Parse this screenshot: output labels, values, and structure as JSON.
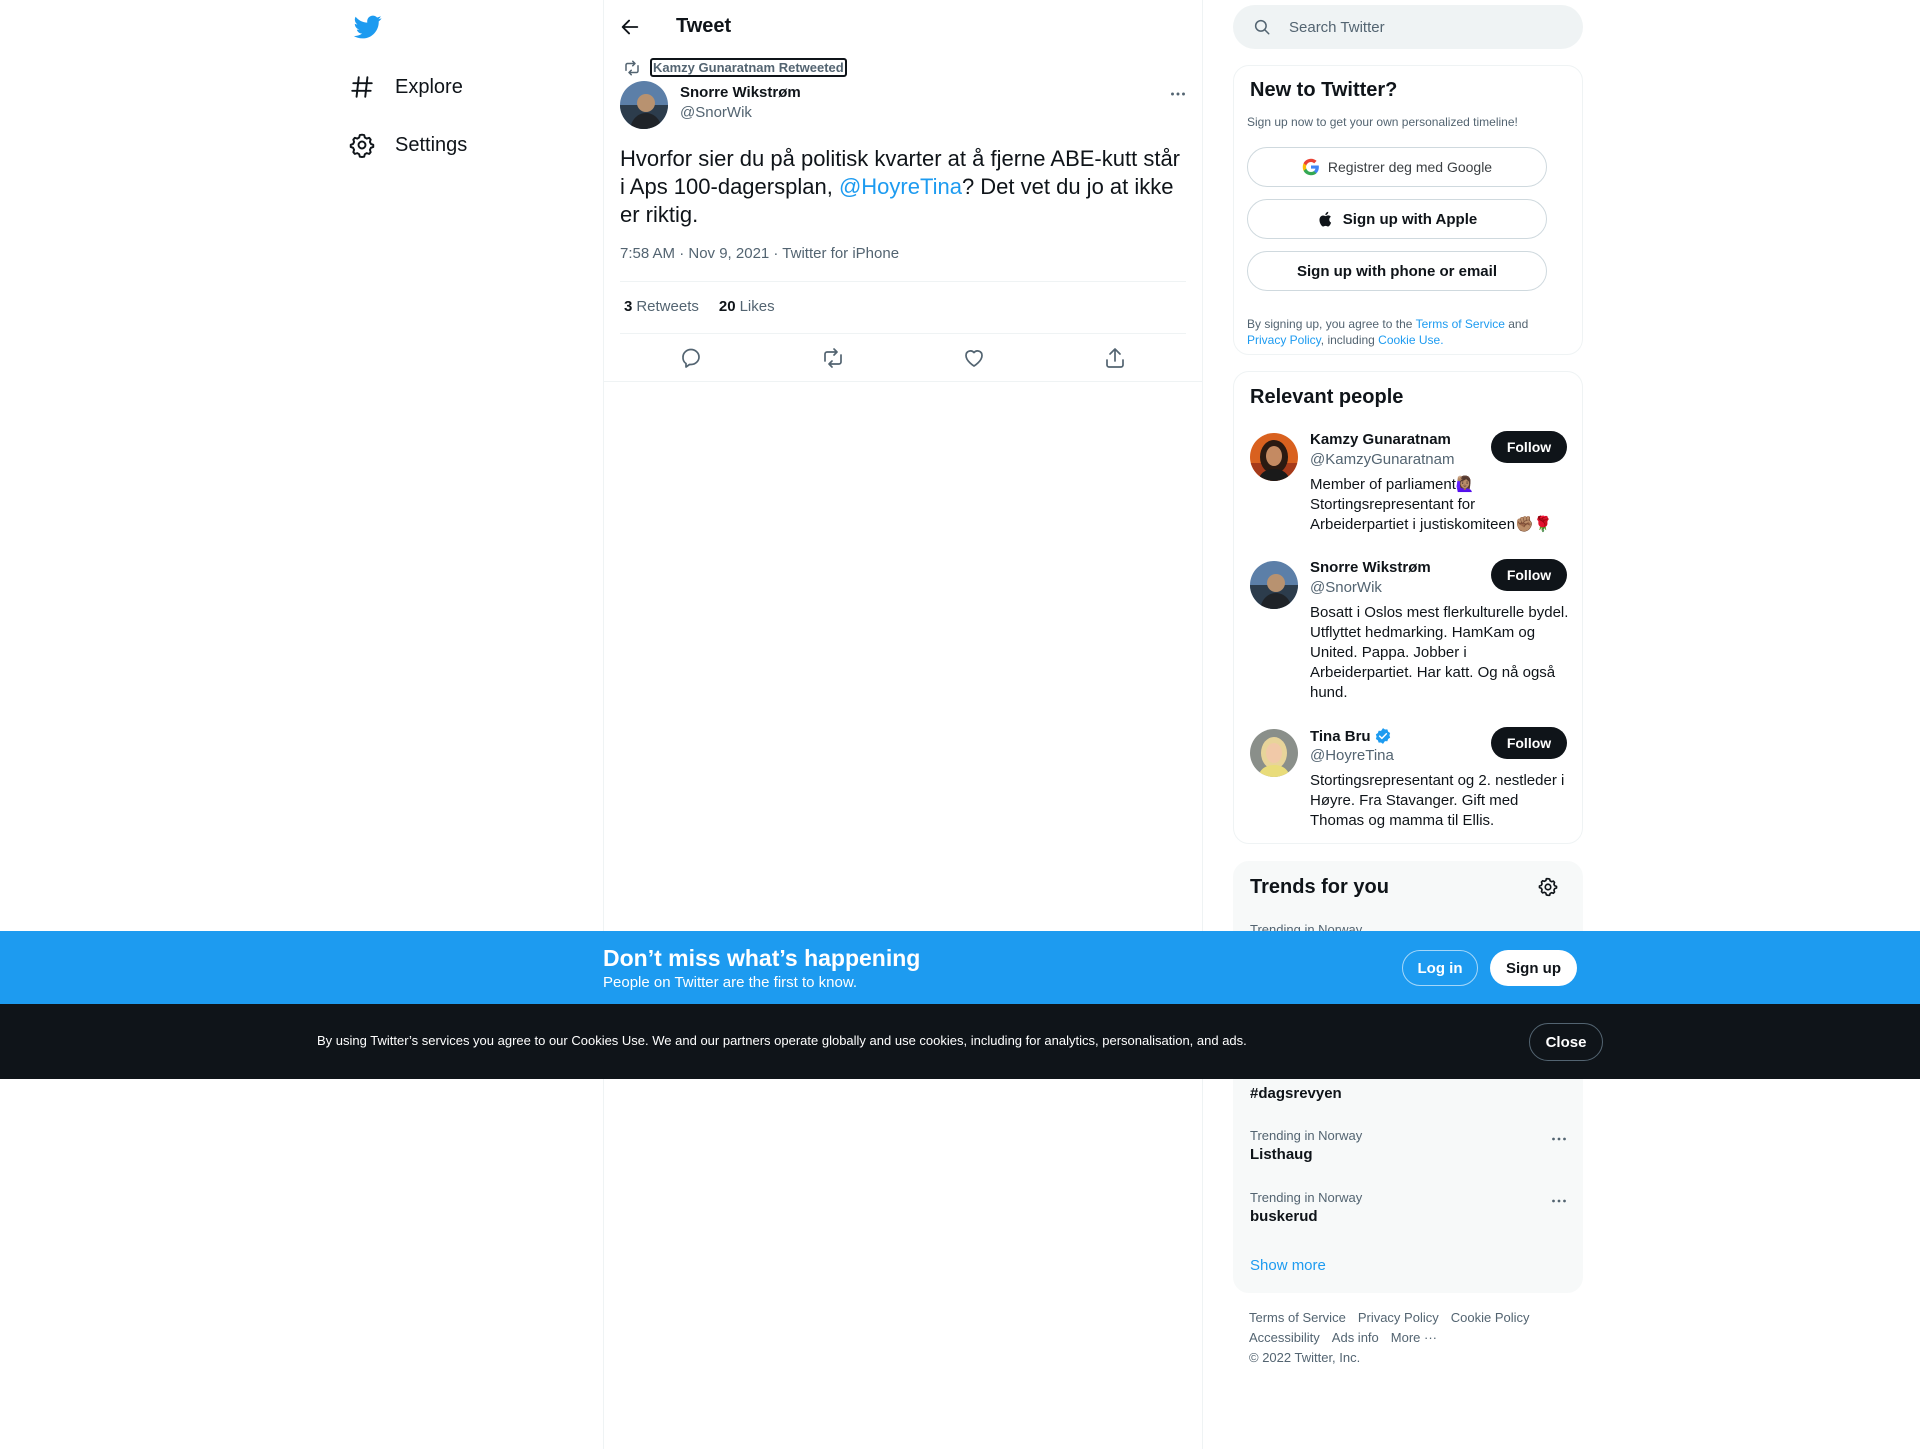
{
  "nav": {
    "items": [
      {
        "label": "Explore",
        "icon": "hashtag-icon"
      },
      {
        "label": "Settings",
        "icon": "gear-icon"
      }
    ]
  },
  "header": {
    "title": "Tweet"
  },
  "tweet": {
    "retweeted_by": "Kamzy Gunaratnam Retweeted",
    "author_name": "Snorre Wikstrøm",
    "author_handle": "@SnorWik",
    "text_before": "Hvorfor sier du på politisk kvarter at å fjerne ABE-kutt står i Aps 100-dagersplan, ",
    "mention": "@HoyreTina",
    "text_after": "? Det vet du jo at ikke er riktig.",
    "meta": "7:58 AM · Nov 9, 2021 · Twitter for iPhone",
    "retweets_count": "3",
    "retweets_label": "Retweets",
    "likes_count": "20",
    "likes_label": "Likes"
  },
  "search": {
    "placeholder": "Search Twitter"
  },
  "signup": {
    "title": "New to Twitter?",
    "subtitle": "Sign up now to get your own personalized timeline!",
    "google": "Registrer deg med Google",
    "apple": "Sign up with Apple",
    "phone": "Sign up with phone or email",
    "legal_1": "By signing up, you agree to the ",
    "tos": "Terms of Service",
    "legal_2": " and ",
    "privacy": "Privacy Policy",
    "legal_3": ", including ",
    "cookie": "Cookie Use."
  },
  "relevant": {
    "title": "Relevant people",
    "follow_label": "Follow",
    "people": [
      {
        "name": "Kamzy Gunaratnam",
        "handle": "@KamzyGunaratnam",
        "bio": "Member of parliament🙋🏽‍♀️ Stortingsrepresentant for Arbeiderpartiet i justiskomiteen✊🏽🌹",
        "verified": false
      },
      {
        "name": "Snorre Wikstrøm",
        "handle": "@SnorWik",
        "bio": "Bosatt i Oslos mest flerkulturelle bydel. Utflyttet hedmarking. HamKam og United. Pappa. Jobber i Arbeiderpartiet. Har katt. Og nå også hund.",
        "verified": false
      },
      {
        "name": "Tina Bru",
        "handle": "@HoyreTina",
        "bio": "Stortingsrepresentant og 2. nestleder i Høyre. Fra Stavanger. Gift med Thomas og mamma til Ellis.",
        "verified": true
      }
    ]
  },
  "trends": {
    "title": "Trends for you",
    "items": [
      {
        "context": "Trending in Norway",
        "name": ""
      },
      {
        "context": "",
        "name": "#dagsrevyen"
      },
      {
        "context": "Trending in Norway",
        "name": "Listhaug"
      },
      {
        "context": "Trending in Norway",
        "name": "buskerud"
      }
    ],
    "show_more": "Show more"
  },
  "footer": {
    "links_row1": [
      "Terms of Service",
      "Privacy Policy",
      "Cookie Policy"
    ],
    "links_row2": [
      "Accessibility",
      "Ads info",
      "More ···"
    ],
    "copyright": "© 2022 Twitter, Inc."
  },
  "banner": {
    "title": "Don’t miss what’s happening",
    "subtitle": "People on Twitter are the first to know.",
    "login": "Log in",
    "signup": "Sign up"
  },
  "cookie_bar": {
    "text": "By using Twitter’s services you agree to our Cookies Use. We and our partners operate globally and use cookies, including for analytics, personalisation, and ads.",
    "close": "Close"
  },
  "colors": {
    "accent": "#1d9bf0",
    "text": "#0f1419",
    "secondary": "#536471",
    "cookie_bg": "#0f1419"
  }
}
